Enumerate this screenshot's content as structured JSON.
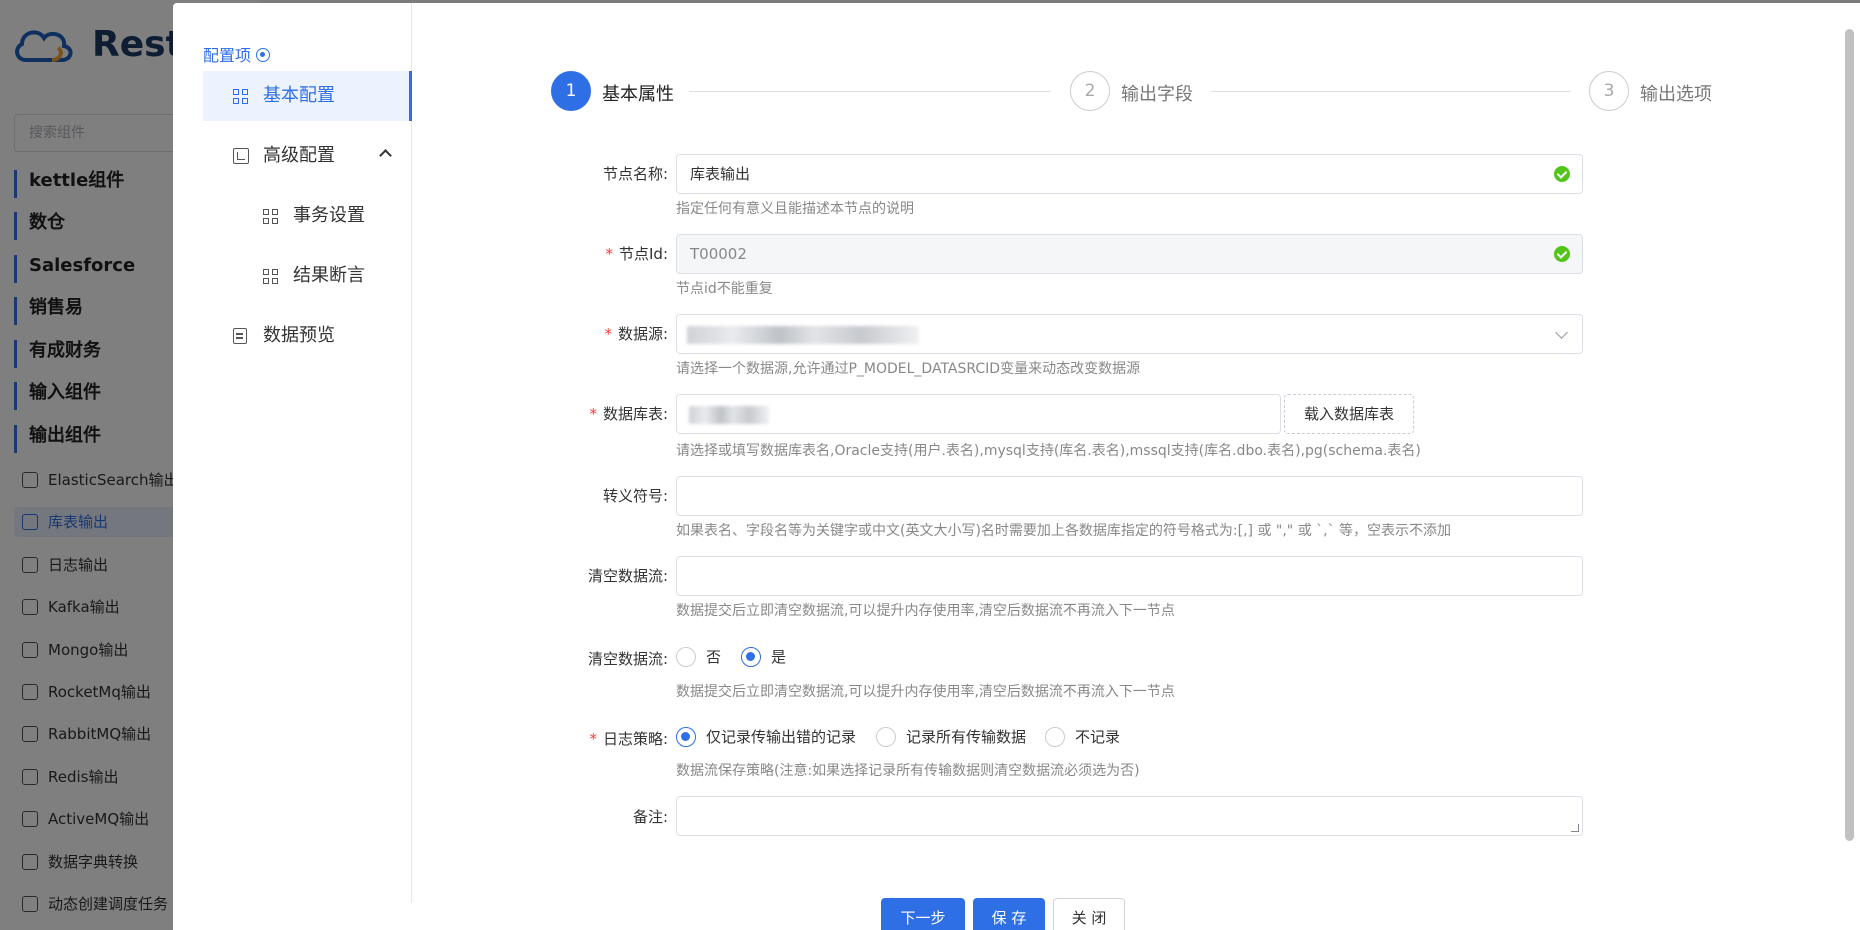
{
  "background": {
    "brand": "Rest",
    "search_placeholder": "搜索组件",
    "groups": [
      "kettle组件",
      "数仓",
      "Salesforce",
      "销售易",
      "有成财务",
      "输入组件",
      "输出组件"
    ],
    "items": [
      "ElasticSearch输出",
      "库表输出",
      "日志输出",
      "Kafka输出",
      "Mongo输出",
      "RocketMq输出",
      "RabbitMQ输出",
      "Redis输出",
      "ActiveMQ输出",
      "数据字典转换",
      "动态创建调度任务"
    ]
  },
  "nav": {
    "title": "配置项",
    "items": {
      "basic": "基本配置",
      "advanced": "高级配置",
      "transaction": "事务设置",
      "assertion": "结果断言",
      "preview": "数据预览"
    }
  },
  "steps": [
    {
      "num": "1",
      "label": "基本属性"
    },
    {
      "num": "2",
      "label": "输出字段"
    },
    {
      "num": "3",
      "label": "输出选项"
    }
  ],
  "form": {
    "node_name": {
      "label": "节点名称:",
      "value": "库表输出",
      "hint": "指定任何有意义且能描述本节点的说明"
    },
    "node_id": {
      "label": "节点Id:",
      "value": "T00002",
      "hint": "节点id不能重复"
    },
    "datasource": {
      "label": "数据源:",
      "hint": "请选择一个数据源,允许通过P_MODEL_DATASRCID变量来动态改变数据源"
    },
    "db_table": {
      "label": "数据库表:",
      "button": "载入数据库表",
      "hint": "请选择或填写数据库表名,Oracle支持(用户.表名),mysql支持(库名.表名),mssql支持(库名.dbo.表名),pg(schema.表名)"
    },
    "escape": {
      "label": "转义符号:",
      "value": "",
      "hint": "如果表名、字段名等为关键字或中文(英文大小写)名时需要加上各数据库指定的符号格式为:[,] 或 \",\" 或 `,` 等，空表示不添加"
    },
    "clear_stream_input": {
      "label": "清空数据流:",
      "value": "",
      "hint": "数据提交后立即清空数据流,可以提升内存使用率,清空后数据流不再流入下一节点"
    },
    "clear_stream_radio": {
      "label": "清空数据流:",
      "options": [
        "否",
        "是"
      ],
      "selected": "是",
      "hint": "数据提交后立即清空数据流,可以提升内存使用率,清空后数据流不再流入下一节点"
    },
    "log_strategy": {
      "label": "日志策略:",
      "options": [
        "仅记录传输出错的记录",
        "记录所有传输数据",
        "不记录"
      ],
      "selected": "仅记录传输出错的记录",
      "hint": "数据流保存策略(注意:如果选择记录所有传输数据则清空数据流必须选为否)"
    },
    "remark": {
      "label": "备注:",
      "value": ""
    }
  },
  "footer": {
    "next": "下一步",
    "save": "保 存",
    "close": "关 闭"
  }
}
